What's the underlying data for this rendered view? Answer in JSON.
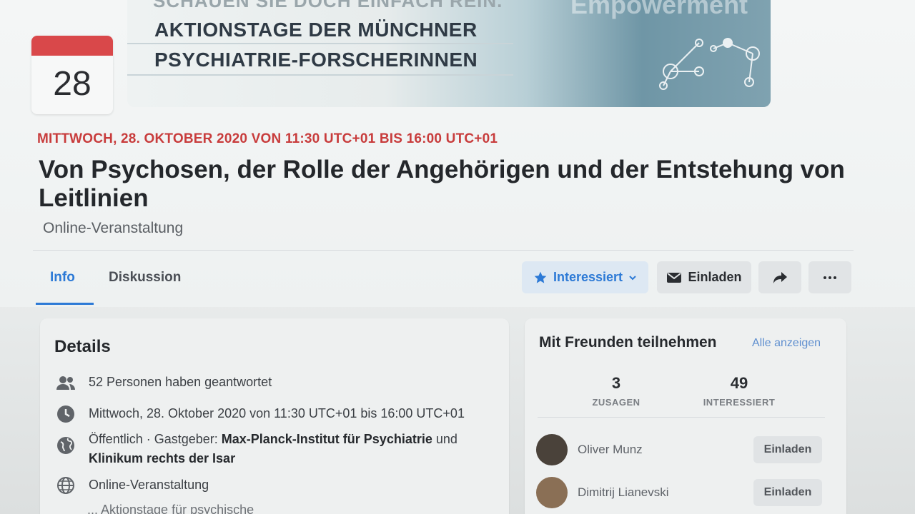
{
  "date_badge": {
    "day": "28"
  },
  "banner": {
    "faded_line": "SCHAUEN SIE DOCH EINFACH REIN.",
    "line1": "AKTIONSTAGE DER MÜNCHNER",
    "line2": "PSYCHIATRIE-FORSCHERINNEN",
    "watermark": "Empowerment"
  },
  "event": {
    "datetime": "MITTWOCH, 28. OKTOBER 2020 VON 11:30 UTC+01 BIS 16:00 UTC+01",
    "title": "Von Psychosen, der Rolle der Angehörigen und der Entstehung von Leitlinien",
    "subtitle": "Online-Veranstaltung"
  },
  "tabs": [
    {
      "label": "Info",
      "active": true
    },
    {
      "label": "Diskussion",
      "active": false
    }
  ],
  "actions": {
    "interested": "Interessiert",
    "invite": "Einladen"
  },
  "details": {
    "heading": "Details",
    "responded": "52 Personen haben geantwortet",
    "time": "Mittwoch, 28. Oktober 2020 von 11:30 UTC+01 bis 16:00 UTC+01",
    "host_prefix": "Öffentlich · Gastgeber: ",
    "host1": "Max-Planck-Institut für Psychiatrie",
    "host_and": " und",
    "host2": "Klinikum rechts der Isar",
    "location": "Online-Veranstaltung",
    "cut_text": "... Aktionstage für psychische"
  },
  "friends": {
    "heading": "Mit Freunden teilnehmen",
    "show_all": "Alle anzeigen",
    "stats": [
      {
        "num": "3",
        "label": "ZUSAGEN"
      },
      {
        "num": "49",
        "label": "INTERESSIERT"
      }
    ],
    "people": [
      {
        "name": "Oliver Munz",
        "button": "Einladen"
      },
      {
        "name": "Dimitrij Lianevski",
        "button": "Einladen"
      }
    ]
  },
  "colors": {
    "accent": "#2d7ad6",
    "date_red": "#c83c3c",
    "badge_red": "#d9484a"
  }
}
